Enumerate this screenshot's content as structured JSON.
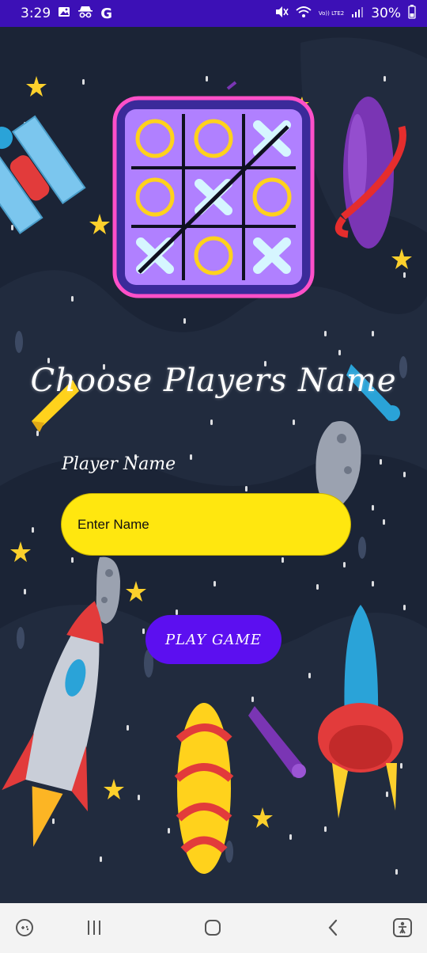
{
  "status_bar": {
    "time": "3:29",
    "volte_label": "Vo)) LTE2",
    "battery": "30%",
    "icons": [
      "gallery-icon",
      "incognito-icon",
      "google-icon",
      "mute-icon",
      "wifi-icon",
      "signal-icon",
      "battery-icon"
    ]
  },
  "screen": {
    "title": "Choose Players Name",
    "player_label": "Player Name",
    "name_input": {
      "value": "",
      "placeholder": "Enter Name"
    },
    "play_button": "PLAY GAME"
  },
  "colors": {
    "status_bar": "#3c10b6",
    "background": "#1b2436",
    "input_fill": "#ffe70f",
    "button_fill": "#5c0ff0",
    "nav_bar": "#f3f3f3"
  },
  "nav_bar": {
    "icons": [
      "game-launcher-icon",
      "recents-icon",
      "home-icon",
      "back-icon",
      "accessibility-icon"
    ]
  }
}
